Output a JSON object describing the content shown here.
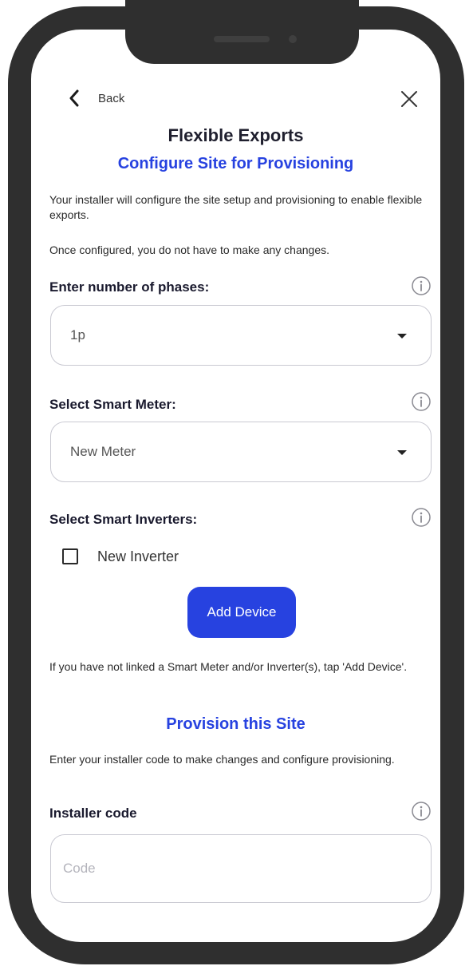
{
  "header": {
    "back_label": "Back",
    "back_icon": "chevron-left-icon",
    "close_icon": "close-icon"
  },
  "title": "Flexible Exports",
  "configure": {
    "heading": "Configure Site for Provisioning",
    "intro_1": "Your installer will configure the site setup and provisioning to enable flexible exports.",
    "intro_2": "Once configured, you do not have to make any changes."
  },
  "phases": {
    "label": "Enter number of phases:",
    "value": "1p"
  },
  "smart_meter": {
    "label": "Select Smart Meter:",
    "value": "New Meter"
  },
  "inverters": {
    "label": "Select Smart Inverters:",
    "items": [
      {
        "label": "New Inverter",
        "checked": false
      }
    ]
  },
  "add_device": {
    "label": "Add Device",
    "hint": "If you have not linked a Smart Meter and/or Inverter(s), tap 'Add Device'."
  },
  "provision": {
    "heading": "Provision this Site",
    "intro": "Enter your installer code to make changes and configure provisioning.",
    "code_label": "Installer code",
    "code_placeholder": "Code",
    "code_value": ""
  },
  "colors": {
    "accent": "#2742e0",
    "frame": "#2f2f2f"
  }
}
